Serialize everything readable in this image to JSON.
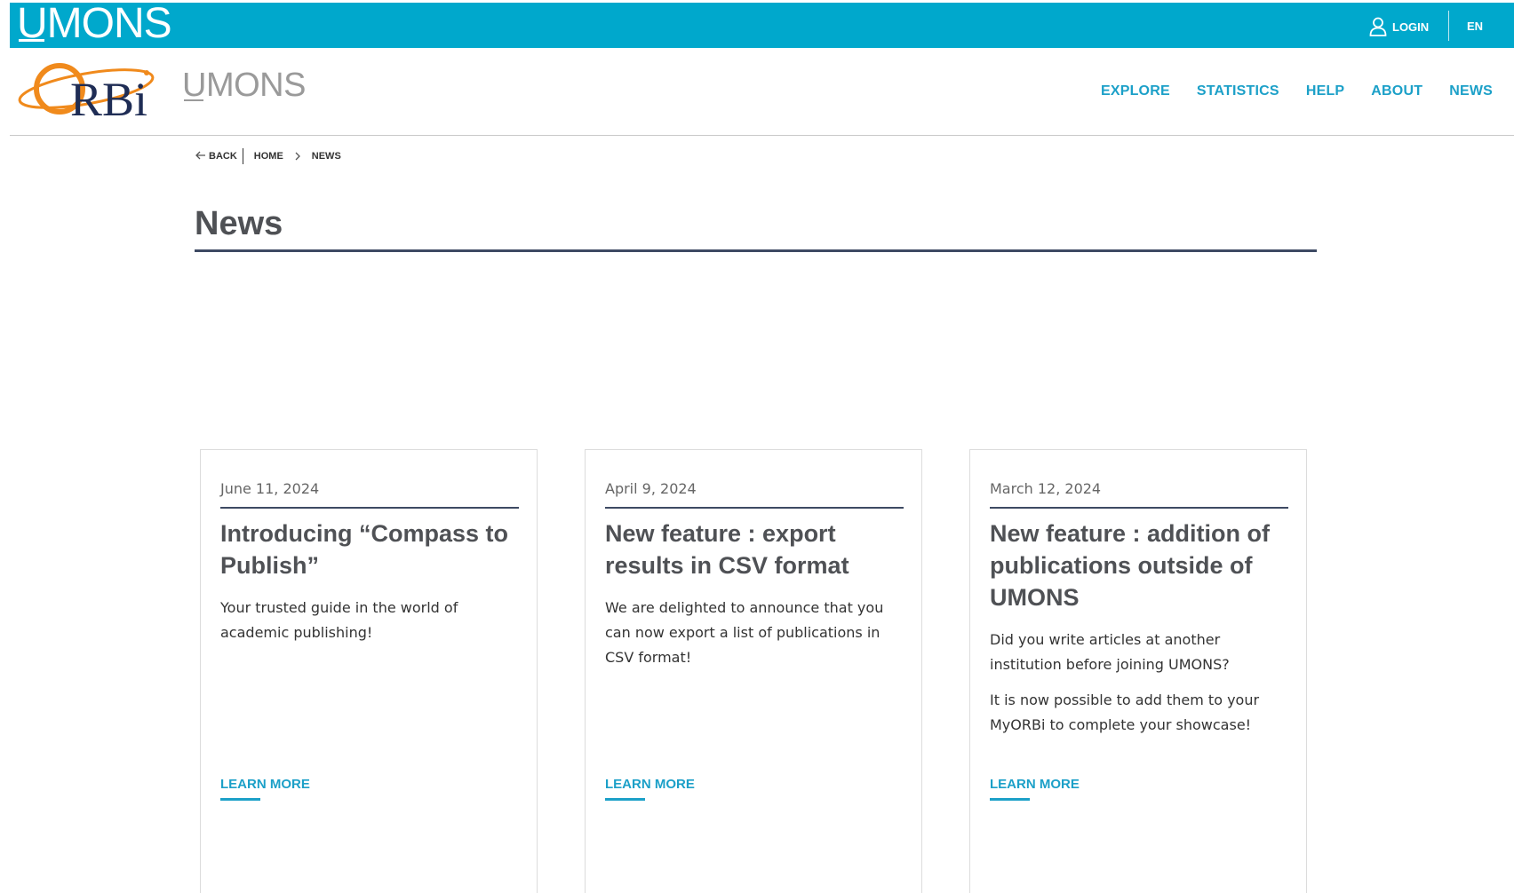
{
  "topbar": {
    "brand": "UMONS",
    "login_label": "LOGIN",
    "language": "EN",
    "color": "#00a8cc"
  },
  "header": {
    "logo_text": "ORBi",
    "institution": "UMONS",
    "nav": [
      "EXPLORE",
      "STATISTICS",
      "HELP",
      "ABOUT",
      "NEWS"
    ]
  },
  "breadcrumb": {
    "back": "BACK",
    "home": "HOME",
    "current": "NEWS"
  },
  "page": {
    "title": "News"
  },
  "cards": [
    {
      "date": "June 11, 2024",
      "title": "Introducing “Compass to Publish”",
      "excerpt": [
        "Your trusted guide in the world of academic publishing!"
      ],
      "link": "LEARN MORE"
    },
    {
      "date": "April 9, 2024",
      "title": "New feature : export results in CSV format",
      "excerpt": [
        "We are delighted to announce that you can now export a list of publications in CSV format!"
      ],
      "link": "LEARN MORE"
    },
    {
      "date": "March 12, 2024",
      "title": "New feature : addition of publications outside of UMONS",
      "excerpt": [
        "Did you write articles at another institution before joining UMONS?",
        "It is now possible to add them to your MyORBi to complete your showcase!"
      ],
      "link": "LEARN MORE"
    }
  ],
  "icons": {
    "login": "user-icon",
    "back": "arrow-left-icon",
    "breadcrumb_separator": "chevron-right-icon"
  }
}
